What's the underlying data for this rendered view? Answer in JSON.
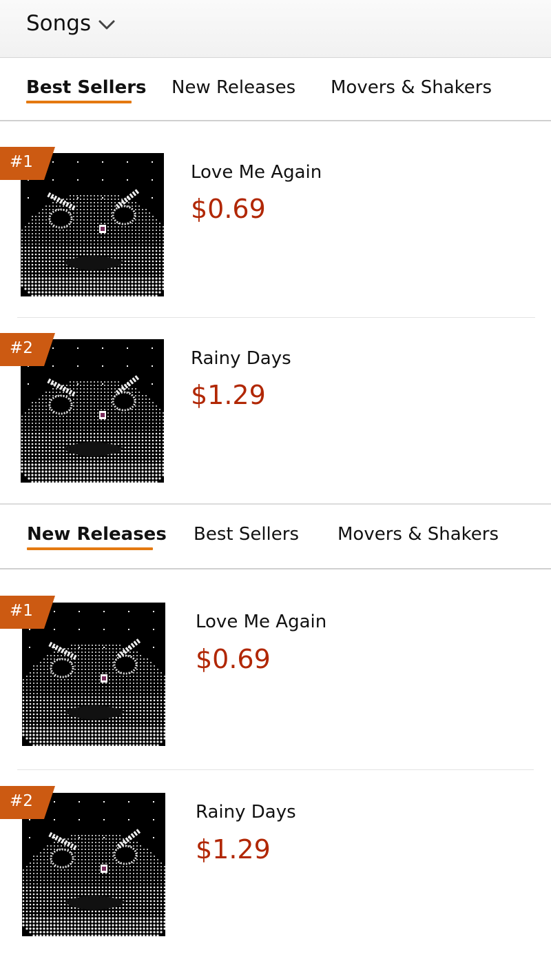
{
  "header": {
    "title": "Songs",
    "chevron_icon": "chevron-down-icon"
  },
  "colors": {
    "accent": "#e47911",
    "badge": "#cc5a12",
    "price": "#b12704"
  },
  "sections": [
    {
      "tabs": [
        {
          "label": "Best Sellers",
          "active": true
        },
        {
          "label": "New Releases",
          "active": false
        },
        {
          "label": "Movers & Shakers",
          "active": false
        }
      ],
      "items": [
        {
          "rank": "#1",
          "title": "Love Me Again",
          "price": "$0.69"
        },
        {
          "rank": "#2",
          "title": "Rainy Days",
          "price": "$1.29"
        }
      ]
    },
    {
      "tabs": [
        {
          "label": "New Releases",
          "active": true
        },
        {
          "label": "Best Sellers",
          "active": false
        },
        {
          "label": "Movers & Shakers",
          "active": false
        }
      ],
      "items": [
        {
          "rank": "#1",
          "title": "Love Me Again",
          "price": "$0.69"
        },
        {
          "rank": "#2",
          "title": "Rainy Days",
          "price": "$1.29"
        }
      ]
    }
  ]
}
